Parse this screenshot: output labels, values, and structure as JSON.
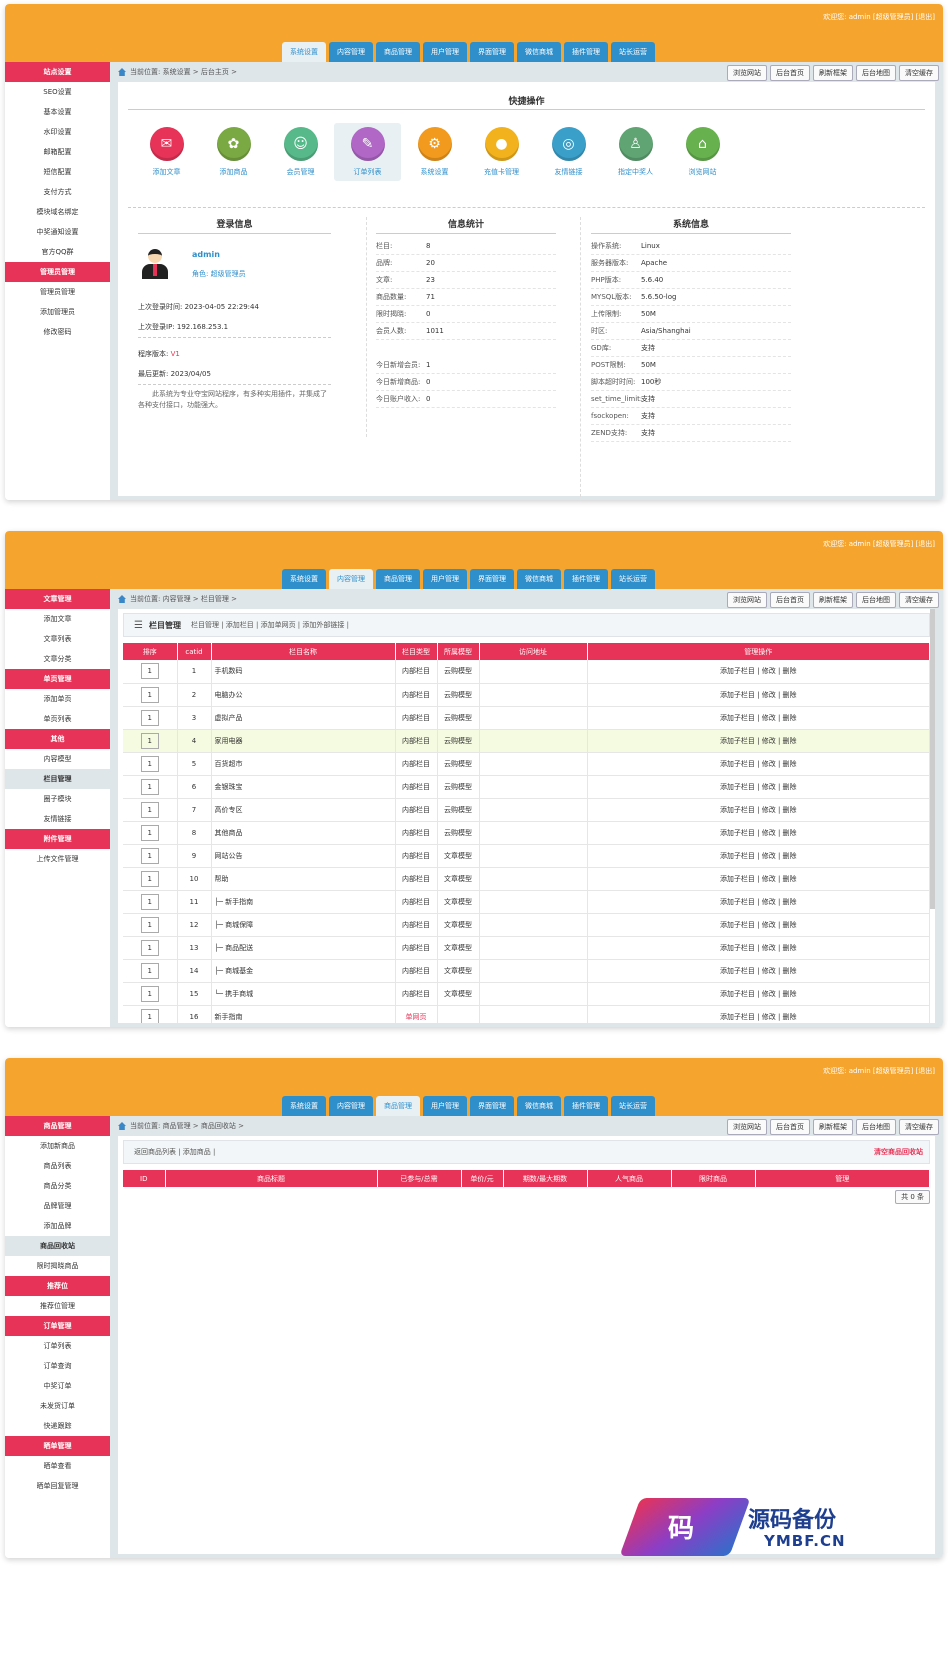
{
  "header": {
    "welcome": "欢迎您:  admin [超级管理员]  [退出]",
    "tabs": [
      "系统设置",
      "内容管理",
      "商品管理",
      "用户管理",
      "界面管理",
      "微信商城",
      "插件管理",
      "站长运营"
    ]
  },
  "quick_buttons": [
    "浏览网站",
    "后台首页",
    "刷新框架",
    "后台地图",
    "清空缓存"
  ],
  "panel1": {
    "breadcrumb": "当前位置: 系统设置 > 后台主页 >",
    "sidebar": [
      {
        "t": "g",
        "l": "站点设置"
      },
      {
        "t": "i",
        "l": "SEO设置"
      },
      {
        "t": "i",
        "l": "基本设置"
      },
      {
        "t": "i",
        "l": "水印设置"
      },
      {
        "t": "i",
        "l": "邮箱配置"
      },
      {
        "t": "i",
        "l": "短信配置"
      },
      {
        "t": "i",
        "l": "支付方式"
      },
      {
        "t": "i",
        "l": "模块域名绑定"
      },
      {
        "t": "i",
        "l": "中奖通知设置"
      },
      {
        "t": "i",
        "l": "官方QQ群"
      },
      {
        "t": "g",
        "l": "管理员管理"
      },
      {
        "t": "i",
        "l": "管理员管理"
      },
      {
        "t": "i",
        "l": "添加管理员"
      },
      {
        "t": "i",
        "l": "修改密码"
      }
    ],
    "quick_title": "快捷操作",
    "quick": [
      {
        "l": "添加文章",
        "c": "#e63357",
        "i": "✉"
      },
      {
        "l": "添加商品",
        "c": "#7aa842",
        "i": "✿"
      },
      {
        "l": "会员管理",
        "c": "#57b98a",
        "i": "☺"
      },
      {
        "l": "订单列表",
        "c": "#b067c6",
        "i": "✎"
      },
      {
        "l": "系统设置",
        "c": "#f29a1d",
        "i": "⚙"
      },
      {
        "l": "充值卡管理",
        "c": "#f2b21d",
        "i": "●"
      },
      {
        "l": "友情链接",
        "c": "#3aa0c9",
        "i": "◎"
      },
      {
        "l": "指定中奖人",
        "c": "#5fa472",
        "i": "♙"
      },
      {
        "l": "浏览网站",
        "c": "#67b24f",
        "i": "⌂"
      }
    ],
    "login": {
      "title": "登录信息",
      "user": "admin",
      "role": "角色: 超级管理员",
      "last_time": "上次登录时间: 2023-04-05 22:29:44",
      "last_ip": "上次登录IP: 192.168.253.1",
      "ver_label": "程序版本: ",
      "ver": "V1",
      "updated": "最后更新: 2023/04/05",
      "desc": "此系统为专业夺宝网站程序，有多种实用插件，并集成了各种支付接口，功能强大。"
    },
    "stats": {
      "title": "信息统计",
      "rows": [
        [
          "栏目:",
          "8"
        ],
        [
          "品牌:",
          "20"
        ],
        [
          "文章:",
          "23"
        ],
        [
          "商品数量:",
          "71"
        ],
        [
          "限时揭晓:",
          "0"
        ],
        [
          "会员人数:",
          "1011"
        ]
      ],
      "today": [
        [
          "今日新增会员:",
          "1"
        ],
        [
          "今日新增商品:",
          "0"
        ],
        [
          "今日账户收入:",
          "0"
        ]
      ]
    },
    "sys": {
      "title": "系统信息",
      "rows": [
        [
          "操作系统:",
          "Linux",
          ""
        ],
        [
          "服务器版本:",
          "Apache",
          ""
        ],
        [
          "PHP版本:",
          "5.6.40",
          ""
        ],
        [
          "MYSQL版本:",
          "5.6.50-log",
          ""
        ],
        [
          "上传限制:",
          "50M",
          ""
        ],
        [
          "时区:",
          "Asia/Shanghai",
          ""
        ],
        [
          "GD库:",
          "支持",
          "b"
        ],
        [
          "POST限制:",
          "50M",
          ""
        ],
        [
          "脚本超时时间:",
          "100秒",
          ""
        ],
        [
          "set_time_limit:",
          "支持",
          "b"
        ],
        [
          "fsockopen:",
          "支持",
          "b"
        ],
        [
          "ZEND支持:",
          "支持",
          "b"
        ]
      ]
    }
  },
  "panel2": {
    "breadcrumb": "当前位置: 内容管理 > 栏目管理 >",
    "sidebar": [
      {
        "t": "g",
        "l": "文章管理"
      },
      {
        "t": "i",
        "l": "添加文章"
      },
      {
        "t": "i",
        "l": "文章列表"
      },
      {
        "t": "i",
        "l": "文章分类"
      },
      {
        "t": "g",
        "l": "单页管理"
      },
      {
        "t": "i",
        "l": "添加单页"
      },
      {
        "t": "i",
        "l": "单页列表"
      },
      {
        "t": "g",
        "l": "其他"
      },
      {
        "t": "i",
        "l": "内容模型"
      },
      {
        "t": "c",
        "l": "栏目管理"
      },
      {
        "t": "i",
        "l": "圈子模块"
      },
      {
        "t": "i",
        "l": "友情链接"
      },
      {
        "t": "g",
        "l": "附件管理"
      },
      {
        "t": "i",
        "l": "上传文件管理"
      }
    ],
    "title": "栏目管理",
    "links": "栏目管理 | 添加栏目 | 添加单网页 | 添加外部链接 |",
    "headers": [
      "排序",
      "catid",
      "栏目名称",
      "栏目类型",
      "所属模型",
      "访问地址",
      "管理操作"
    ],
    "rows": [
      [
        "1",
        "1",
        "手机数码",
        "内部栏目",
        "云购模型"
      ],
      [
        "1",
        "2",
        "电脑办公",
        "内部栏目",
        "云购模型"
      ],
      [
        "1",
        "3",
        "虚拟产品",
        "内部栏目",
        "云购模型"
      ],
      [
        "1",
        "4",
        "家用电器",
        "内部栏目",
        "云购模型"
      ],
      [
        "1",
        "5",
        "百货超市",
        "内部栏目",
        "云购模型"
      ],
      [
        "1",
        "6",
        "金银珠宝",
        "内部栏目",
        "云购模型"
      ],
      [
        "1",
        "7",
        "高价专区",
        "内部栏目",
        "云购模型"
      ],
      [
        "1",
        "8",
        "其他商品",
        "内部栏目",
        "云购模型"
      ],
      [
        "1",
        "9",
        "网站公告",
        "内部栏目",
        "文章模型"
      ],
      [
        "1",
        "10",
        "帮助",
        "内部栏目",
        "文章模型"
      ],
      [
        "1",
        "11",
        "├─ 新手指南",
        "内部栏目",
        "文章模型"
      ],
      [
        "1",
        "12",
        "├─ 商城保障",
        "内部栏目",
        "文章模型"
      ],
      [
        "1",
        "13",
        "├─ 商品配送",
        "内部栏目",
        "文章模型"
      ],
      [
        "1",
        "14",
        "├─ 商城基金",
        "内部栏目",
        "文章模型"
      ],
      [
        "1",
        "15",
        "└─ 携手商城",
        "内部栏目",
        "文章模型"
      ],
      [
        "1",
        "16",
        "新手指南",
        "单网页",
        ""
      ]
    ],
    "ops": "添加子栏目 | 修改 | 删除"
  },
  "panel3": {
    "breadcrumb": "当前位置: 商品管理 > 商品回收站 >",
    "sidebar": [
      {
        "t": "g",
        "l": "商品管理"
      },
      {
        "t": "i",
        "l": "添加新商品"
      },
      {
        "t": "i",
        "l": "商品列表"
      },
      {
        "t": "i",
        "l": "商品分类"
      },
      {
        "t": "i",
        "l": "品牌管理"
      },
      {
        "t": "i",
        "l": "添加品牌"
      },
      {
        "t": "c",
        "l": "商品回收站"
      },
      {
        "t": "i",
        "l": "限时揭晓商品"
      },
      {
        "t": "g",
        "l": "推荐位"
      },
      {
        "t": "i",
        "l": "推荐位管理"
      },
      {
        "t": "g",
        "l": "订单管理"
      },
      {
        "t": "i",
        "l": "订单列表"
      },
      {
        "t": "i",
        "l": "订单查询"
      },
      {
        "t": "i",
        "l": "中奖订单"
      },
      {
        "t": "i",
        "l": "未发货订单"
      },
      {
        "t": "i",
        "l": "快递跟踪"
      },
      {
        "t": "g",
        "l": "晒单管理"
      },
      {
        "t": "i",
        "l": "晒单查看"
      },
      {
        "t": "i",
        "l": "晒单回复管理"
      }
    ],
    "links": "返回商品列表 | 添加商品 |",
    "clear": "清空商品回收站",
    "headers": [
      "ID",
      "商品标题",
      "已参与/总需",
      "单价/元",
      "期数/最大期数",
      "人气商品",
      "限时商品",
      "管理"
    ],
    "total": "共 0 条"
  },
  "watermark": {
    "char": "码",
    "name": "源码备份",
    "url": "YMBF.CN"
  }
}
